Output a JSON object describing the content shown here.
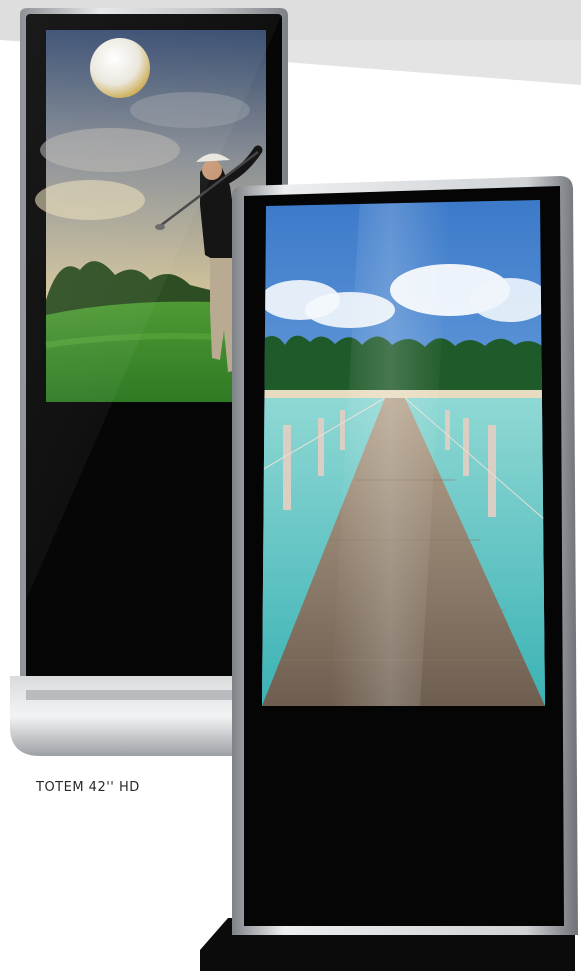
{
  "caption": "TOTEM 42'' HD",
  "products": [
    {
      "name": "totem-back",
      "screen_scene": "golf"
    },
    {
      "name": "totem-front",
      "screen_scene": "tropical-pier"
    }
  ],
  "colors": {
    "frame_silver": "#c9ccd0",
    "bezel_black": "#0a0a0a",
    "sky_blue": "#4f8fd6",
    "sea_turquoise": "#5fc4c0",
    "grass_green": "#3f8f2e"
  }
}
